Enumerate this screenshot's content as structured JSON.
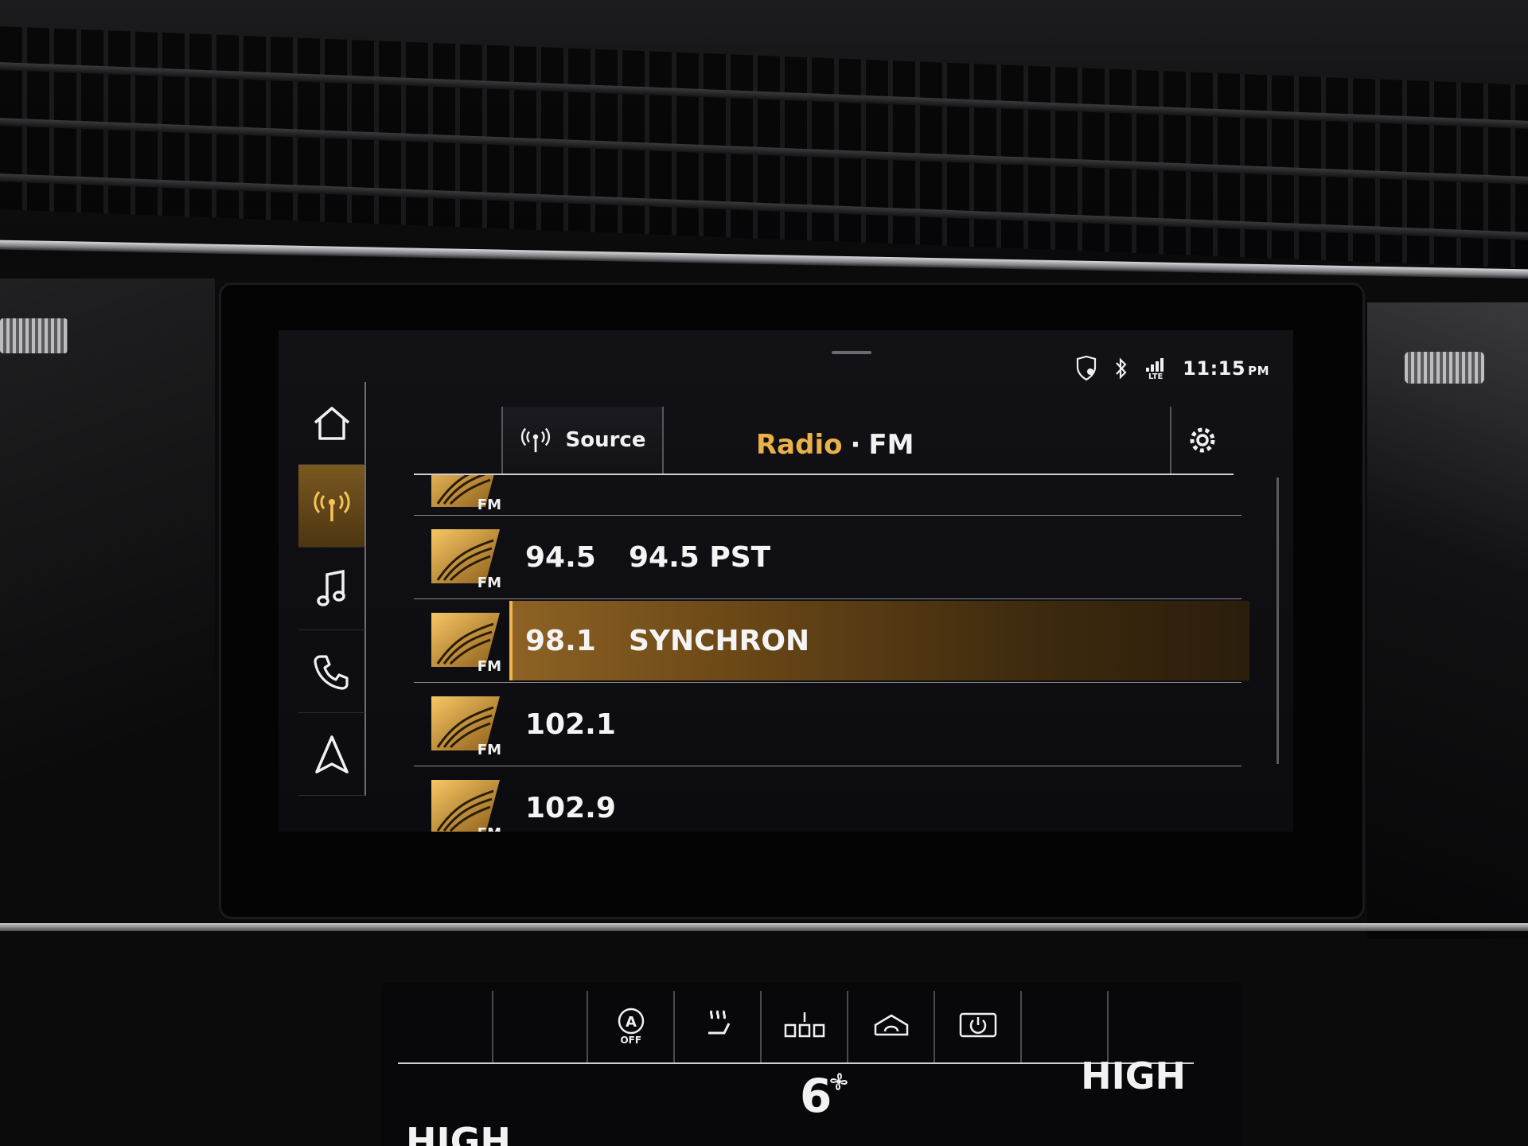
{
  "status": {
    "time": "11:15",
    "ampm": "PM",
    "network": "LTE"
  },
  "rail": [
    {
      "id": "home",
      "icon": "home-icon"
    },
    {
      "id": "radio",
      "icon": "radio-antenna-icon",
      "active": true
    },
    {
      "id": "media",
      "icon": "music-note-icon"
    },
    {
      "id": "phone",
      "icon": "phone-icon"
    },
    {
      "id": "navigation",
      "icon": "navigation-arrow-icon"
    }
  ],
  "header": {
    "source_label": "Source",
    "title_main": "Radio",
    "title_sep": "·",
    "title_band": "FM"
  },
  "stations": [
    {
      "frequency": "",
      "name": "",
      "band": "FM",
      "partial": true
    },
    {
      "frequency": "94.5",
      "name": "94.5 PST",
      "band": "FM"
    },
    {
      "frequency": "98.1",
      "name": "SYNCHRON",
      "band": "FM",
      "selected": true
    },
    {
      "frequency": "102.1",
      "name": "",
      "band": "FM"
    },
    {
      "frequency": "102.9",
      "name": "",
      "band": "FM"
    }
  ],
  "climate": {
    "auto_off_label": "OFF",
    "fan_level": "6",
    "right_level": "HIGH",
    "left_level": "HIGH"
  },
  "colors": {
    "accent": "#e9b14a",
    "highlight": "#8d6224"
  }
}
